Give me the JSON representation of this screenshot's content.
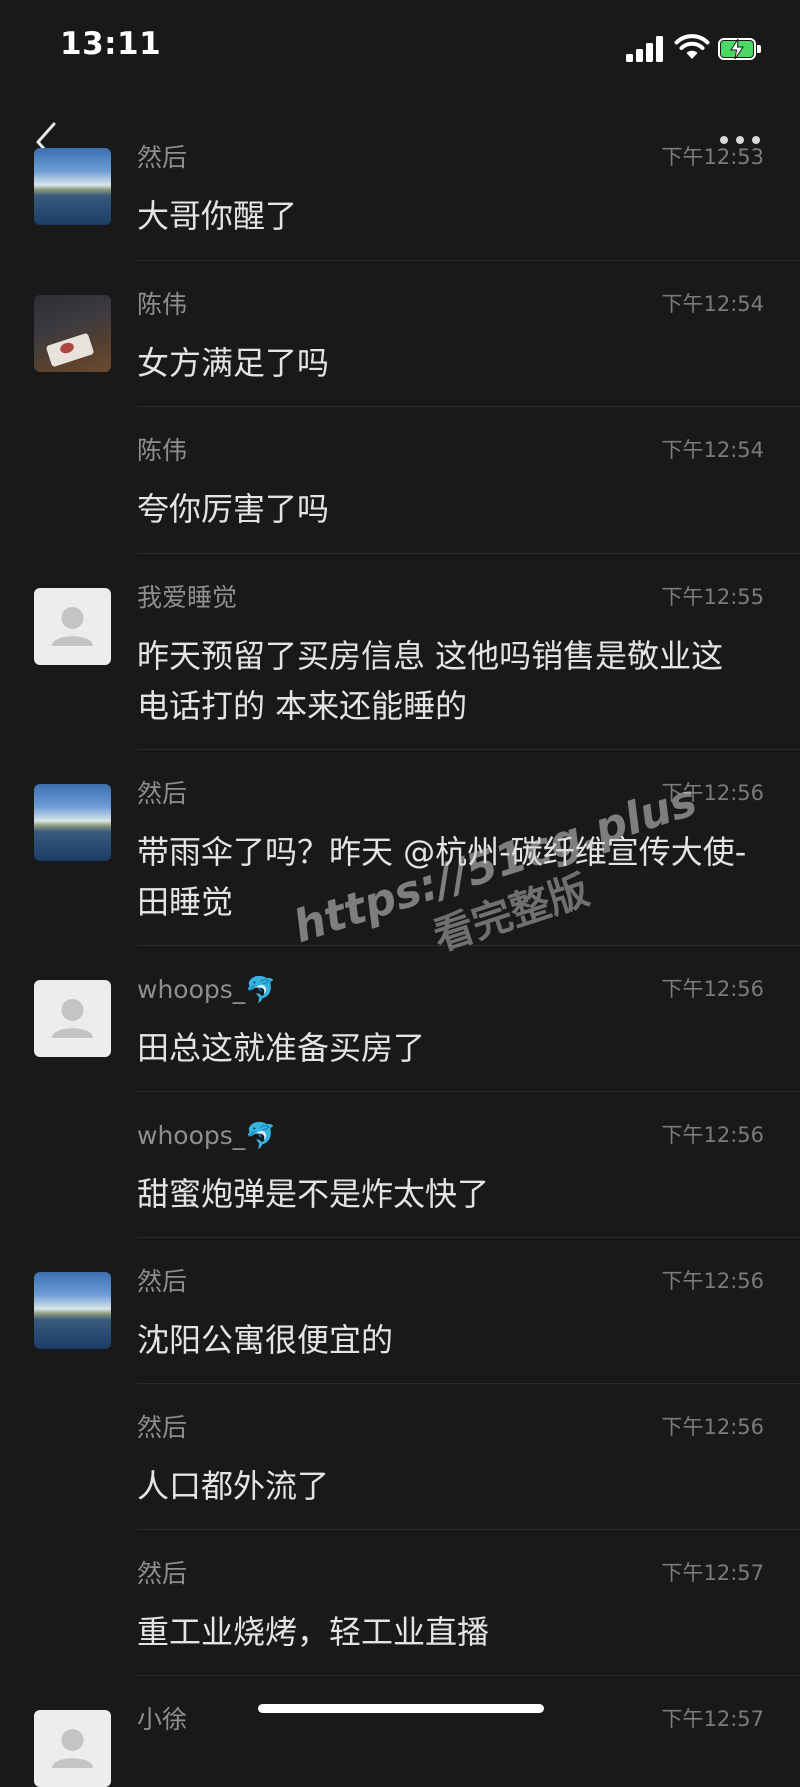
{
  "status_bar": {
    "time": "13:11"
  },
  "messages": [
    {
      "sender": "然后",
      "time": "下午12:53",
      "text": "大哥你醒了",
      "avatar": "lake"
    },
    {
      "sender": "陈伟",
      "time": "下午12:54",
      "text": "女方满足了吗",
      "avatar": "hands"
    },
    {
      "sender": "陈伟",
      "time": "下午12:54",
      "text": "夸你厉害了吗",
      "avatar": "none"
    },
    {
      "sender": "我爱睡觉",
      "time": "下午12:55",
      "text": "昨天预留了买房信息 这他吗销售是敬业这电话打的 本来还能睡的",
      "avatar": "default"
    },
    {
      "sender": "然后",
      "time": "下午12:56",
      "text": "带雨伞了吗？昨天 @杭州-碳纤维宣传大使-田睡觉",
      "avatar": "lake"
    },
    {
      "sender": "whoops_🐬",
      "time": "下午12:56",
      "text": "田总这就准备买房了",
      "avatar": "default"
    },
    {
      "sender": "whoops_🐬",
      "time": "下午12:56",
      "text": "甜蜜炮弹是不是炸太快了",
      "avatar": "none"
    },
    {
      "sender": "然后",
      "time": "下午12:56",
      "text": "沈阳公寓很便宜的",
      "avatar": "lake"
    },
    {
      "sender": "然后",
      "time": "下午12:56",
      "text": "人口都外流了",
      "avatar": "none"
    },
    {
      "sender": "然后",
      "time": "下午12:57",
      "text": "重工业烧烤，轻工业直播",
      "avatar": "none"
    },
    {
      "sender": "小徐",
      "time": "下午12:57",
      "text": "",
      "avatar": "default"
    }
  ],
  "watermark": {
    "line1": "https://51cg.plus",
    "line2": "看完整版"
  },
  "icons": {
    "back": "back-chevron-icon",
    "more": "more-dots-icon",
    "avatar_default": "default-user-icon"
  },
  "colors": {
    "background": "#191919",
    "battery_fill": "#4cd964",
    "meta_text": "#8e8e8e"
  }
}
